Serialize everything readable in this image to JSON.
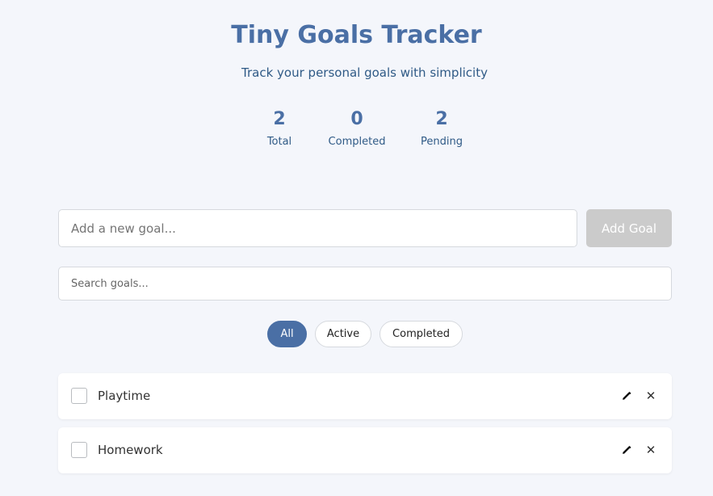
{
  "header": {
    "title": "Tiny Goals Tracker",
    "subtitle": "Track your personal goals with simplicity"
  },
  "stats": {
    "total": {
      "value": "2",
      "label": "Total"
    },
    "completed": {
      "value": "0",
      "label": "Completed"
    },
    "pending": {
      "value": "2",
      "label": "Pending"
    }
  },
  "new_goal": {
    "value": "",
    "placeholder": "Add a new goal...",
    "button_label": "Add Goal",
    "button_enabled": false
  },
  "search": {
    "value": "",
    "placeholder": "Search goals..."
  },
  "filters": {
    "selected": "All",
    "items": [
      "All",
      "Active",
      "Completed"
    ]
  },
  "goals": [
    {
      "text": "Playtime",
      "completed": false,
      "edit_icon": "pencil-icon",
      "delete_icon": "close-icon"
    },
    {
      "text": "Homework",
      "completed": false,
      "edit_icon": "pencil-icon",
      "delete_icon": "close-icon"
    }
  ],
  "colors": {
    "accent": "#4a6fa5",
    "subtitle": "#2f5a86",
    "background": "#f4f6fb",
    "disabled_button": "#cbcbcb"
  }
}
